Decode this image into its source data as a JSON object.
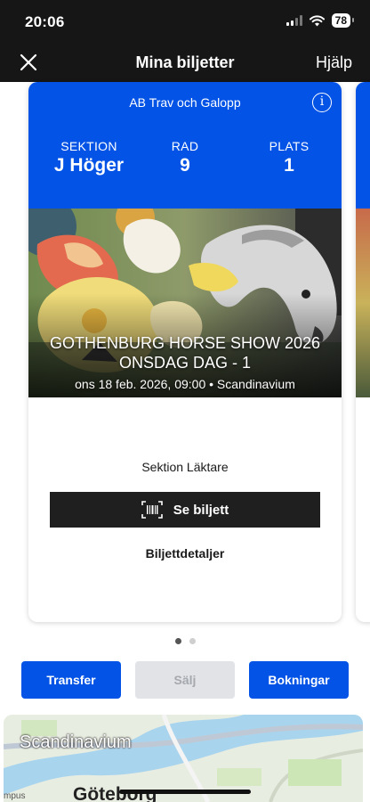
{
  "status_bar": {
    "time": "20:06",
    "battery": "78"
  },
  "header": {
    "title": "Mina biljetter",
    "help_label": "Hjälp"
  },
  "ticket": {
    "organizer": "AB Trav och Galopp",
    "seat": [
      {
        "label": "SEKTION",
        "value": "J Höger"
      },
      {
        "label": "RAD",
        "value": "9"
      },
      {
        "label": "PLATS",
        "value": "1"
      }
    ],
    "event_title_line1": "GOTHENBURG HORSE SHOW 2026",
    "event_title_line2": "ONSDAG DAG - 1",
    "event_meta": "ons 18 feb. 2026, 09:00 • Scandinavium",
    "section_text": "Sektion Läktare",
    "see_ticket_label": "Se biljett",
    "details_label": "Biljettdetaljer"
  },
  "pagination": {
    "total": 2,
    "active": 0
  },
  "actions": {
    "transfer_label": "Transfer",
    "sell_label": "Sälj",
    "bookings_label": "Bokningar"
  },
  "map": {
    "venue_label": "Scandinavium",
    "city_label": "Göteborg",
    "side_label": "mpus"
  },
  "colors": {
    "brand_blue": "#0253e6",
    "header_bg": "#161616",
    "button_dark": "#1f1f1f"
  }
}
